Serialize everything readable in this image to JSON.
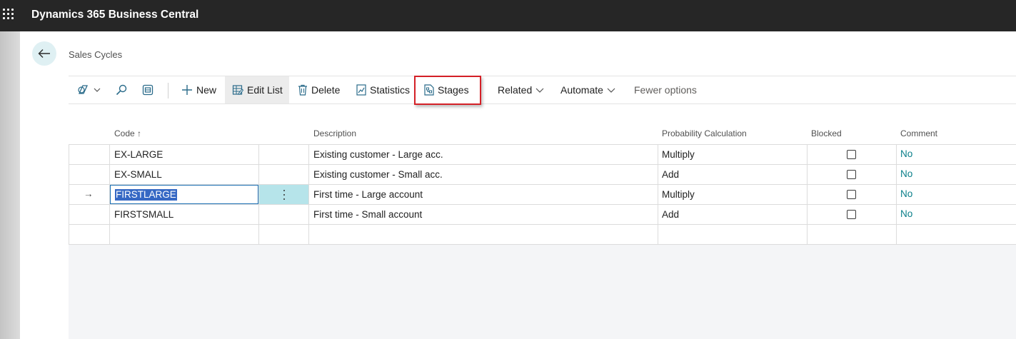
{
  "app": {
    "title": "Dynamics 365 Business Central"
  },
  "page": {
    "title": "Sales Cycles"
  },
  "toolbar": {
    "new": "New",
    "edit_list": "Edit List",
    "delete": "Delete",
    "statistics": "Statistics",
    "stages": "Stages",
    "related": "Related",
    "automate": "Automate",
    "fewer_options": "Fewer options"
  },
  "table": {
    "columns": {
      "code": "Code",
      "code_sort": "↑",
      "description": "Description",
      "probability": "Probability Calculation",
      "blocked": "Blocked",
      "comment": "Comment"
    },
    "rows": [
      {
        "code": "EX-LARGE",
        "description": "Existing customer - Large acc.",
        "probability": "Multiply",
        "blocked": false,
        "comment": "No"
      },
      {
        "code": "EX-SMALL",
        "description": "Existing customer - Small acc.",
        "probability": "Add",
        "blocked": false,
        "comment": "No"
      },
      {
        "code": "FIRSTLARGE",
        "description": "First time - Large account",
        "probability": "Multiply",
        "blocked": false,
        "comment": "No",
        "selected": true,
        "indicator": "→"
      },
      {
        "code": "FIRSTSMALL",
        "description": "First time - Small account",
        "probability": "Add",
        "blocked": false,
        "comment": "No"
      }
    ]
  },
  "colors": {
    "topbar": "#262626",
    "accent": "#0a7f8a",
    "selection": "#3568c4",
    "highlight_border": "#d42027"
  }
}
